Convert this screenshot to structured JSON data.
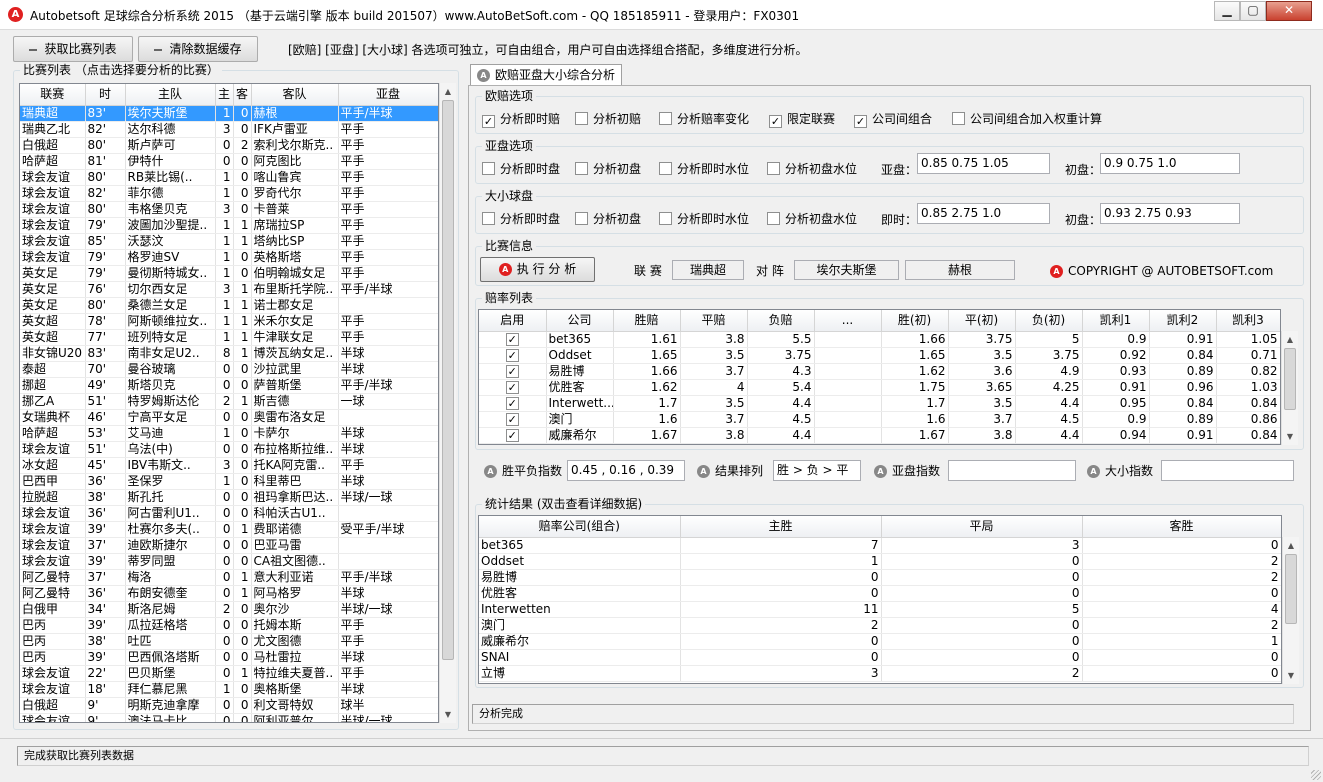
{
  "window": {
    "title": "Autobetsoft 足球综合分析系统 2015 （基于云端引擎 版本 build 201507）www.AutoBetSoft.com  - QQ 185185911  - 登录用户：FX0301",
    "app_icon": "A",
    "min_glyph": "▁",
    "max_glyph": "▢",
    "close_glyph": "✕"
  },
  "toolbar": {
    "fetch_label": "获取比赛列表",
    "clear_label": "清除数据缓存",
    "info": "[欧赔] [亚盘] [大小球] 各选项可独立，可自由组合，用户可自由选择组合搭配，多维度进行分析。"
  },
  "match_list": {
    "title": "比赛列表 （点击选择要分析的比赛）",
    "columns": [
      "联赛",
      "时",
      "主队",
      "主",
      "客",
      "客队",
      "亚盘"
    ],
    "rows": [
      [
        "瑞典超",
        "83'",
        "埃尔夫斯堡",
        "1",
        "0",
        "赫根",
        "平手/半球"
      ],
      [
        "瑞典乙北",
        "82'",
        "达尔科德",
        "3",
        "0",
        "IFK卢雷亚",
        "平手"
      ],
      [
        "白俄超",
        "80'",
        "斯卢萨可",
        "0",
        "2",
        "索利戈尔斯克..",
        "平手"
      ],
      [
        "哈萨超",
        "81'",
        "伊特什",
        "0",
        "0",
        "阿克图比",
        "平手"
      ],
      [
        "球会友谊",
        "80'",
        "RB莱比锡(..",
        "1",
        "0",
        "喀山鲁宾",
        "平手"
      ],
      [
        "球会友谊",
        "82'",
        "菲尔德",
        "1",
        "0",
        "罗奇代尔",
        "平手"
      ],
      [
        "球会友谊",
        "80'",
        "韦格堡贝克",
        "3",
        "0",
        "卡普莱",
        "平手"
      ],
      [
        "球会友谊",
        "79'",
        "波圖加沙聖提..",
        "1",
        "1",
        "席瑞拉SP",
        "平手"
      ],
      [
        "球会友谊",
        "85'",
        "沃瑟汶",
        "1",
        "1",
        "塔纳比SP",
        "平手"
      ],
      [
        "球会友谊",
        "79'",
        "格罗迪SV",
        "1",
        "0",
        "英格斯塔",
        "平手"
      ],
      [
        "英女足",
        "79'",
        "曼彻斯特城女..",
        "1",
        "0",
        "伯明翰城女足",
        "平手"
      ],
      [
        "英女足",
        "76'",
        "切尔西女足",
        "3",
        "1",
        "布里斯托学院..",
        "平手/半球"
      ],
      [
        "英女足",
        "80'",
        "桑德兰女足",
        "1",
        "1",
        "诺士郡女足",
        ""
      ],
      [
        "英女超",
        "78'",
        "阿斯顿维拉女..",
        "1",
        "1",
        "米禾尔女足",
        "平手"
      ],
      [
        "英女超",
        "77'",
        "班列特女足",
        "1",
        "1",
        "牛津联女足",
        "平手"
      ],
      [
        "非女锦U20",
        "83'",
        "南非女足U2..",
        "8",
        "1",
        "博茨瓦纳女足..",
        "半球"
      ],
      [
        "泰超",
        "70'",
        "曼谷玻璃",
        "0",
        "0",
        "沙拉武里",
        "半球"
      ],
      [
        "挪超",
        "49'",
        "斯塔贝克",
        "0",
        "0",
        "萨普斯堡",
        "平手/半球"
      ],
      [
        "挪乙A",
        "51'",
        "特罗姆斯达伦",
        "2",
        "1",
        "斯吉德",
        "一球"
      ],
      [
        "女瑞典杯",
        "46'",
        "宁高平女足",
        "0",
        "0",
        "奥雷布洛女足",
        ""
      ],
      [
        "哈萨超",
        "53'",
        "艾马迪",
        "1",
        "0",
        "卡萨尔",
        "半球"
      ],
      [
        "球会友谊",
        "51'",
        "乌法(中)",
        "0",
        "0",
        "布拉格斯拉维..",
        "半球"
      ],
      [
        "冰女超",
        "45'",
        "IBV韦斯文..",
        "3",
        "0",
        "托KA阿克雷..",
        "平手"
      ],
      [
        "巴西甲",
        "36'",
        "圣保罗",
        "1",
        "0",
        "科里蒂巴",
        "半球"
      ],
      [
        "拉脱超",
        "38'",
        "斯孔托",
        "0",
        "0",
        "祖玛拿斯巴达..",
        "半球/一球"
      ],
      [
        "球会友谊",
        "36'",
        "阿古雷利U1..",
        "0",
        "0",
        "科帕沃古U1..",
        ""
      ],
      [
        "球会友谊",
        "39'",
        "杜赛尔多夫(..",
        "0",
        "1",
        "费耶诺德",
        "受平手/半球"
      ],
      [
        "球会友谊",
        "37'",
        "迪欧斯捷尔",
        "0",
        "0",
        "巴亚马雷",
        ""
      ],
      [
        "球会友谊",
        "39'",
        "蒂罗同盟",
        "0",
        "0",
        "CA祖文图德..",
        ""
      ],
      [
        "阿乙曼特",
        "37'",
        "梅洛",
        "0",
        "1",
        "意大利亚诺",
        "平手/半球"
      ],
      [
        "阿乙曼特",
        "36'",
        "布朗安德奎",
        "0",
        "1",
        "阿马格罗",
        "半球"
      ],
      [
        "白俄甲",
        "34'",
        "斯洛尼姆",
        "2",
        "0",
        "奥尔沙",
        "半球/一球"
      ],
      [
        "巴丙",
        "39'",
        "瓜拉廷格塔",
        "0",
        "0",
        "托姆本斯",
        "平手"
      ],
      [
        "巴丙",
        "38'",
        "吐匹",
        "0",
        "0",
        "尤文图德",
        "平手"
      ],
      [
        "巴丙",
        "39'",
        "巴西佩洛塔斯",
        "0",
        "0",
        "马杜雷拉",
        "半球"
      ],
      [
        "球会友谊",
        "22'",
        "巴贝斯堡",
        "0",
        "1",
        "特拉维夫夏普..",
        "平手"
      ],
      [
        "球会友谊",
        "18'",
        "拜仁慕尼黑",
        "1",
        "0",
        "奥格斯堡",
        "半球"
      ],
      [
        "白俄超",
        "9'",
        "明斯克迪拿摩",
        "0",
        "0",
        "利文哥特奴",
        "球半"
      ],
      [
        "球会友谊",
        "9'",
        "澳法马卡比",
        "0",
        "0",
        "阿利亚普尔",
        "半球/一球"
      ]
    ]
  },
  "analysis_tab": {
    "label": "欧赔亚盘大小综合分析"
  },
  "europe": {
    "title": "欧赔选项",
    "options": [
      {
        "label": "分析即时赔",
        "checked": true
      },
      {
        "label": "分析初赔",
        "checked": false
      },
      {
        "label": "分析赔率变化",
        "checked": false
      },
      {
        "label": "限定联赛",
        "checked": true
      },
      {
        "label": "公司间组合",
        "checked": true
      },
      {
        "label": "公司间组合加入权重计算",
        "checked": false
      }
    ]
  },
  "asian": {
    "title": "亚盘选项",
    "options": [
      {
        "label": "分析即时盘",
        "checked": false
      },
      {
        "label": "分析初盘",
        "checked": false
      },
      {
        "label": "分析即时水位",
        "checked": false
      },
      {
        "label": "分析初盘水位",
        "checked": false
      }
    ],
    "live_label": "亚盘：",
    "live_value": "0.85  0.75  1.05",
    "init_label": "初盘：",
    "init_value": "0.9  0.75  1.0"
  },
  "ou": {
    "title": "大小球盘",
    "options": [
      {
        "label": "分析即时盘",
        "checked": false
      },
      {
        "label": "分析初盘",
        "checked": false
      },
      {
        "label": "分析即时水位",
        "checked": false
      },
      {
        "label": "分析初盘水位",
        "checked": false
      }
    ],
    "live_label": "即时：",
    "live_value": "0.85  2.75  1.0",
    "init_label": "初盘：",
    "init_value": "0.93  2.75  0.93"
  },
  "match_info": {
    "title": "比赛信息",
    "run_label": "执 行 分 析",
    "league_label": "联 赛",
    "league_value": "瑞典超",
    "vs_label": "对 阵",
    "home_value": "埃尔夫斯堡",
    "away_value": "赫根",
    "copyright": "COPYRIGHT @ AUTOBETSOFT.com"
  },
  "odds": {
    "title": "赔率列表",
    "columns": [
      "启用",
      "公司",
      "胜赔",
      "平赔",
      "负赔",
      "...",
      "胜(初)",
      "平(初)",
      "负(初)",
      "凯利1",
      "凯利2",
      "凯利3"
    ],
    "rows": [
      [
        "✓",
        "bet365",
        "1.61",
        "3.8",
        "5.5",
        "",
        "1.66",
        "3.75",
        "5",
        "0.9",
        "0.91",
        "1.05"
      ],
      [
        "✓",
        "Oddset",
        "1.65",
        "3.5",
        "3.75",
        "",
        "1.65",
        "3.5",
        "3.75",
        "0.92",
        "0.84",
        "0.71"
      ],
      [
        "✓",
        "易胜博",
        "1.66",
        "3.7",
        "4.3",
        "",
        "1.62",
        "3.6",
        "4.9",
        "0.93",
        "0.89",
        "0.82"
      ],
      [
        "✓",
        "优胜客",
        "1.62",
        "4",
        "5.4",
        "",
        "1.75",
        "3.65",
        "4.25",
        "0.91",
        "0.96",
        "1.03"
      ],
      [
        "✓",
        "Interwett...",
        "1.7",
        "3.5",
        "4.4",
        "",
        "1.7",
        "3.5",
        "4.4",
        "0.95",
        "0.84",
        "0.84"
      ],
      [
        "✓",
        "澳门",
        "1.6",
        "3.7",
        "4.5",
        "",
        "1.6",
        "3.7",
        "4.5",
        "0.9",
        "0.89",
        "0.86"
      ],
      [
        "✓",
        "威廉希尔",
        "1.67",
        "3.8",
        "4.4",
        "",
        "1.67",
        "3.8",
        "4.4",
        "0.94",
        "0.91",
        "0.84"
      ]
    ]
  },
  "indices": {
    "wdl_label": "胜平负指数",
    "wdl_value": "0.45 , 0.16 , 0.39",
    "order_label": "结果排列",
    "order_value": "胜 > 负 > 平",
    "asian_label": "亚盘指数",
    "asian_value": "",
    "ou_label": "大小指数",
    "ou_value": ""
  },
  "stats": {
    "title": "统计结果 (双击查看详细数据)",
    "columns": [
      "赔率公司(组合)",
      "主胜",
      "平局",
      "客胜"
    ],
    "rows": [
      [
        "bet365",
        "7",
        "3",
        "0"
      ],
      [
        "Oddset",
        "1",
        "0",
        "2"
      ],
      [
        "易胜博",
        "0",
        "0",
        "2"
      ],
      [
        "优胜客",
        "0",
        "0",
        "0"
      ],
      [
        "Interwetten",
        "11",
        "5",
        "4"
      ],
      [
        "澳门",
        "2",
        "0",
        "2"
      ],
      [
        "威廉希尔",
        "0",
        "0",
        "1"
      ],
      [
        "SNAI",
        "0",
        "0",
        "0"
      ],
      [
        "立博",
        "3",
        "2",
        "0"
      ]
    ]
  },
  "status": {
    "right": "分析完成",
    "bottom": "完成获取比赛列表数据"
  }
}
